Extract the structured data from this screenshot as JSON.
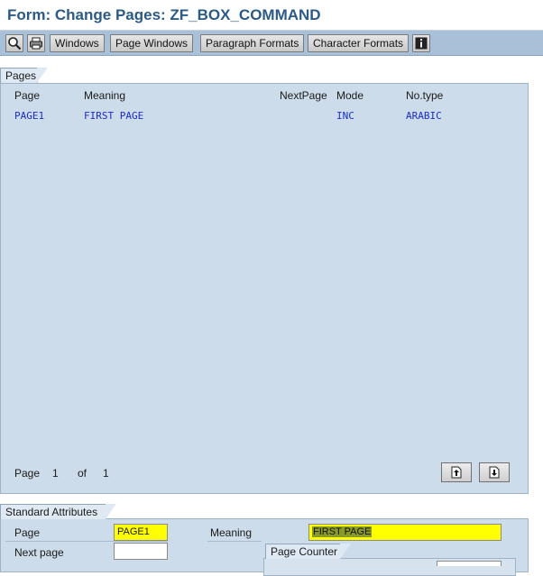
{
  "window": {
    "title": "Form: Change Pages: ZF_BOX_COMMAND"
  },
  "toolbar": {
    "icons": [
      "find-icon",
      "print-icon"
    ],
    "buttons": [
      "Windows",
      "Page Windows",
      "Paragraph Formats",
      "Character Formats"
    ],
    "info_icon": "info-icon"
  },
  "pages_panel": {
    "tab": "Pages",
    "columns": [
      "Page",
      "Meaning",
      "NextPage",
      "Mode",
      "No.type"
    ],
    "rows": [
      {
        "page": "PAGE1",
        "meaning": "FIRST PAGE",
        "nextpage": "",
        "mode": "INC",
        "notype": "ARABIC"
      }
    ],
    "pager": {
      "label": "Page",
      "current": "1",
      "of": "of",
      "total": "1"
    }
  },
  "attributes": {
    "tab": "Standard Attributes",
    "page_label": "Page",
    "page_value": "PAGE1",
    "meaning_label": "Meaning",
    "meaning_value": "FIRST PAGE",
    "next_page_label": "Next page",
    "next_page_value": "",
    "counter_tab": "Page Counter"
  },
  "colors": {
    "accent": "#2b5a86",
    "panel": "#cddcea",
    "highlight": "#ffff00",
    "link": "#1c2cc6"
  }
}
